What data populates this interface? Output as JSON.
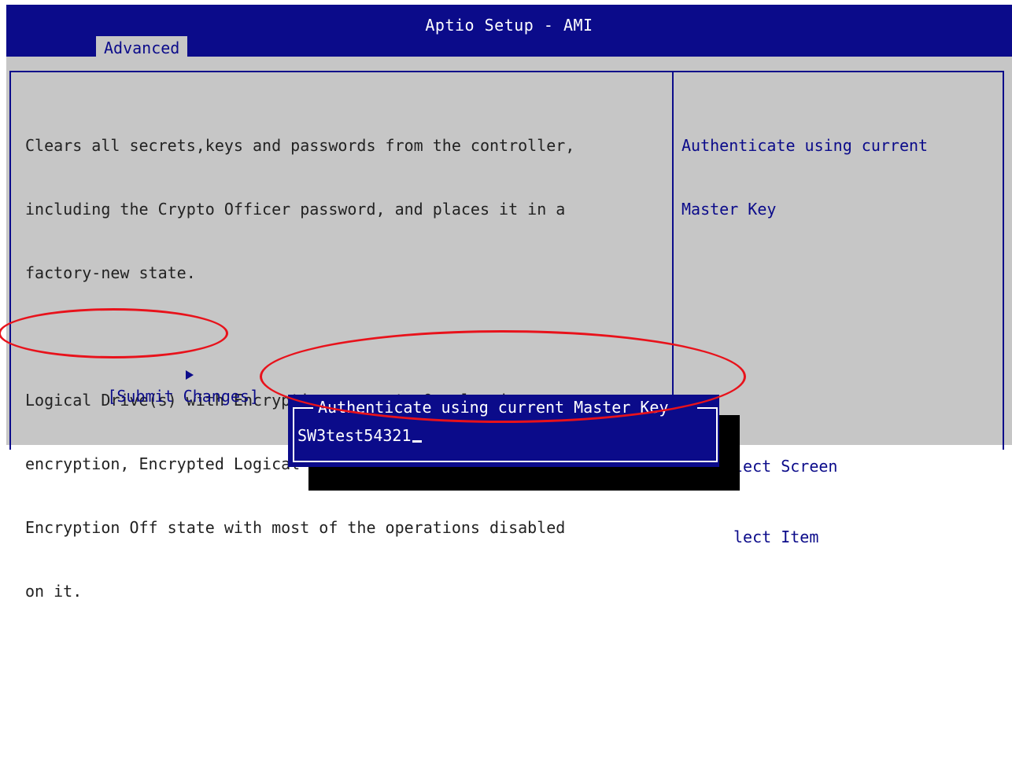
{
  "header": {
    "title": "Aptio Setup - AMI",
    "active_tab": "Advanced"
  },
  "main": {
    "paragraph1": [
      "Clears all secrets,keys and passwords from the controller,",
      "including the Crypto Officer password, and places it in a",
      "factory-new state."
    ],
    "paragraph2": [
      "Logical Drive(s) with Encryption present. On clearing",
      "encryption, Encrypted Logical Drive(s) will be moved to",
      "Encryption Off state with most of the operations disabled",
      "on it."
    ],
    "auth_label": [
      "Authenticate using current Master",
      "Key"
    ],
    "submit_label": "[Submit Changes]"
  },
  "help": {
    "lines": [
      "Authenticate using current",
      "Master Key"
    ]
  },
  "key_hints": [
    "lect Screen",
    "lect Item"
  ],
  "popup": {
    "title": "Authenticate using current Master Key",
    "input_value": "SW3test54321"
  },
  "colors": {
    "bios_blue": "#0b0b8a",
    "bios_gray": "#c6c6c6",
    "annotation_red": "#e8121b"
  }
}
